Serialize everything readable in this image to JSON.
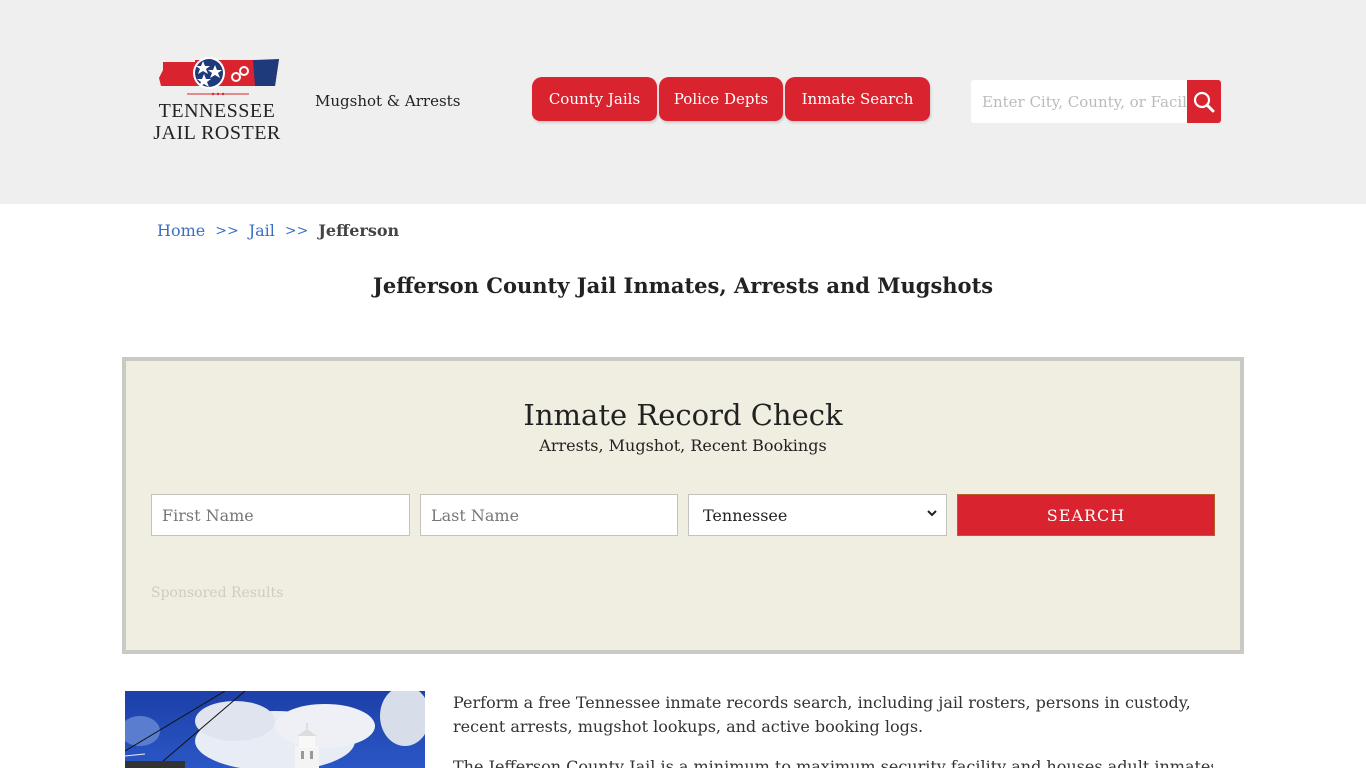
{
  "header": {
    "logo": {
      "line1": "TENNESSEE",
      "line2": "JAIL ROSTER",
      "colors": {
        "red": "#d9232e",
        "navy": "#1e3a7a"
      }
    },
    "tagline": "Mugshot & Arrests",
    "nav": [
      {
        "label": "County Jails"
      },
      {
        "label": "Police Depts"
      },
      {
        "label": "Inmate Search"
      }
    ],
    "search": {
      "placeholder": "Enter City, County, or Facility",
      "value": "",
      "icon": "search-icon"
    }
  },
  "breadcrumb": {
    "items": [
      {
        "label": "Home"
      },
      {
        "label": "Jail"
      }
    ],
    "separator": ">>",
    "current": "Jefferson"
  },
  "page_title": "Jefferson County Jail Inmates, Arrests and Mugshots",
  "record_check": {
    "title": "Inmate Record Check",
    "subtitle": "Arrests, Mugshot, Recent Bookings",
    "first_name": {
      "placeholder": "First Name",
      "value": ""
    },
    "last_name": {
      "placeholder": "Last Name",
      "value": ""
    },
    "state": {
      "selected": "Tennessee"
    },
    "search_label": "SEARCH",
    "sponsored": "Sponsored Results"
  },
  "content": {
    "paragraph1": "Perform a free Tennessee inmate records search, including jail rosters, persons in custody, recent arrests, mugshot lookups, and active booking logs.",
    "paragraph2": "The Jefferson County Jail is a minimum to maximum security facility and houses adult inmates and"
  },
  "colors": {
    "accent": "#d9232e",
    "header_bg": "#efefef",
    "panel_bg": "#f0eee0",
    "link": "#3a6fc4"
  }
}
